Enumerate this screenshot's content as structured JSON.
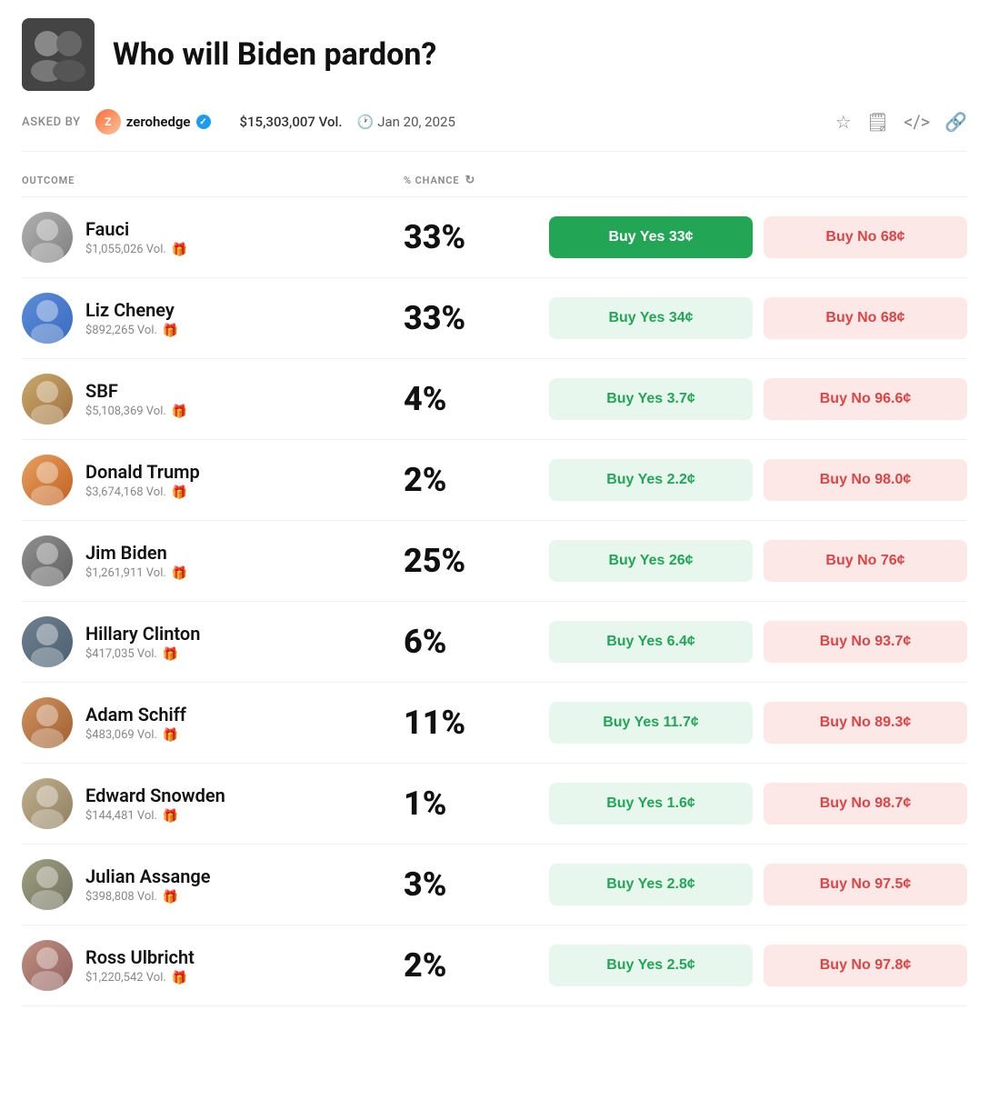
{
  "header": {
    "title": "Who will Biden pardon?",
    "thumbnail_emoji": "👥"
  },
  "meta": {
    "asked_by_label": "ASKED BY",
    "user_name": "zerohedge",
    "volume": "$15,303,007 Vol.",
    "date": "Jan 20, 2025",
    "clock_icon": "🕐"
  },
  "table": {
    "col_outcome": "OUTCOME",
    "col_chance": "% CHANCE",
    "refresh_symbol": "↻"
  },
  "outcomes": [
    {
      "name": "Fauci",
      "volume": "$1,055,026 Vol.",
      "chance": "33%",
      "btn_yes": "Buy Yes 33¢",
      "btn_no": "Buy No 68¢",
      "yes_active": true,
      "avatar_class": "avatar-fauci",
      "avatar_emoji": "👴"
    },
    {
      "name": "Liz Cheney",
      "volume": "$892,265 Vol.",
      "chance": "33%",
      "btn_yes": "Buy Yes 34¢",
      "btn_no": "Buy No 68¢",
      "yes_active": false,
      "avatar_class": "avatar-cheney",
      "avatar_emoji": "👩"
    },
    {
      "name": "SBF",
      "volume": "$5,108,369 Vol.",
      "chance": "4%",
      "btn_yes": "Buy Yes 3.7¢",
      "btn_no": "Buy No 96.6¢",
      "yes_active": false,
      "avatar_class": "avatar-sbf",
      "avatar_emoji": "👨"
    },
    {
      "name": "Donald Trump",
      "volume": "$3,674,168 Vol.",
      "chance": "2%",
      "btn_yes": "Buy Yes 2.2¢",
      "btn_no": "Buy No 98.0¢",
      "yes_active": false,
      "avatar_class": "avatar-trump",
      "avatar_emoji": "👱"
    },
    {
      "name": "Jim Biden",
      "volume": "$1,261,911 Vol.",
      "chance": "25%",
      "btn_yes": "Buy Yes 26¢",
      "btn_no": "Buy No 76¢",
      "yes_active": false,
      "avatar_class": "avatar-biden",
      "avatar_emoji": "👴"
    },
    {
      "name": "Hillary Clinton",
      "volume": "$417,035 Vol.",
      "chance": "6%",
      "btn_yes": "Buy Yes 6.4¢",
      "btn_no": "Buy No 93.7¢",
      "yes_active": false,
      "avatar_class": "avatar-clinton",
      "avatar_emoji": "👩"
    },
    {
      "name": "Adam Schiff",
      "volume": "$483,069 Vol.",
      "chance": "11%",
      "btn_yes": "Buy Yes 11.7¢",
      "btn_no": "Buy No 89.3¢",
      "yes_active": false,
      "avatar_class": "avatar-schiff",
      "avatar_emoji": "👨"
    },
    {
      "name": "Edward Snowden",
      "volume": "$144,481 Vol.",
      "chance": "1%",
      "btn_yes": "Buy Yes 1.6¢",
      "btn_no": "Buy No 98.7¢",
      "yes_active": false,
      "avatar_class": "avatar-snowden",
      "avatar_emoji": "👓"
    },
    {
      "name": "Julian Assange",
      "volume": "$398,808 Vol.",
      "chance": "3%",
      "btn_yes": "Buy Yes 2.8¢",
      "btn_no": "Buy No 97.5¢",
      "yes_active": false,
      "avatar_class": "avatar-assange",
      "avatar_emoji": "👨"
    },
    {
      "name": "Ross Ulbricht",
      "volume": "$1,220,542 Vol.",
      "chance": "2%",
      "btn_yes": "Buy Yes 2.5¢",
      "btn_no": "Buy No 97.8¢",
      "yes_active": false,
      "avatar_class": "avatar-ulbricht",
      "avatar_emoji": "🧑"
    }
  ]
}
